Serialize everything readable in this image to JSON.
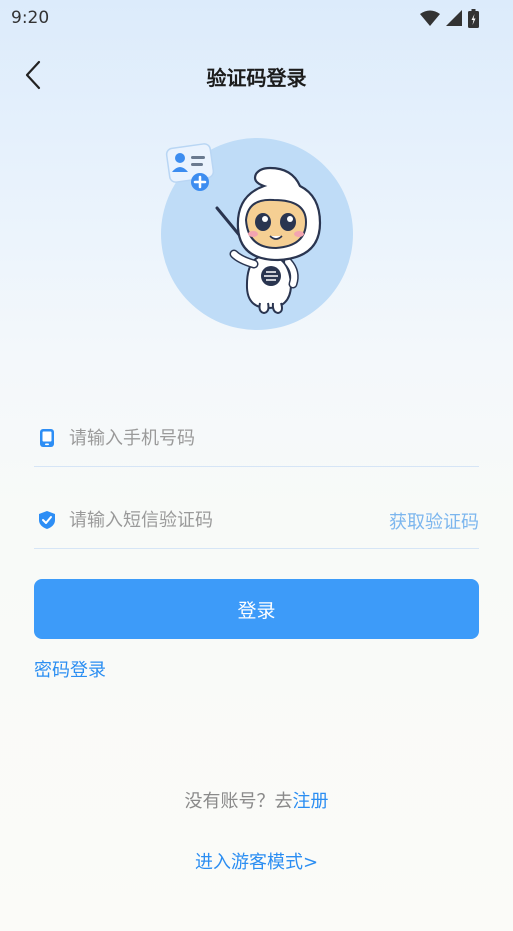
{
  "status_bar": {
    "time": "9:20"
  },
  "header": {
    "title": "验证码登录"
  },
  "form": {
    "phone_placeholder": "请输入手机号码",
    "code_placeholder": "请输入短信验证码",
    "get_code_label": "获取验证码",
    "login_label": "登录",
    "password_login_label": "密码登录"
  },
  "footer": {
    "no_account_text": "没有账号？去",
    "register_label": "注册",
    "guest_mode_label": "进入游客模式>"
  },
  "icons": {
    "back": "chevron-left-icon",
    "phone": "phone-icon",
    "code": "shield-check-icon",
    "wifi": "wifi-icon",
    "signal": "signal-icon",
    "battery": "battery-icon"
  },
  "colors": {
    "primary": "#3d9bf9",
    "link": "#2b8ef2",
    "get_code": "#7cb6ee",
    "placeholder": "#9a9a9a"
  }
}
